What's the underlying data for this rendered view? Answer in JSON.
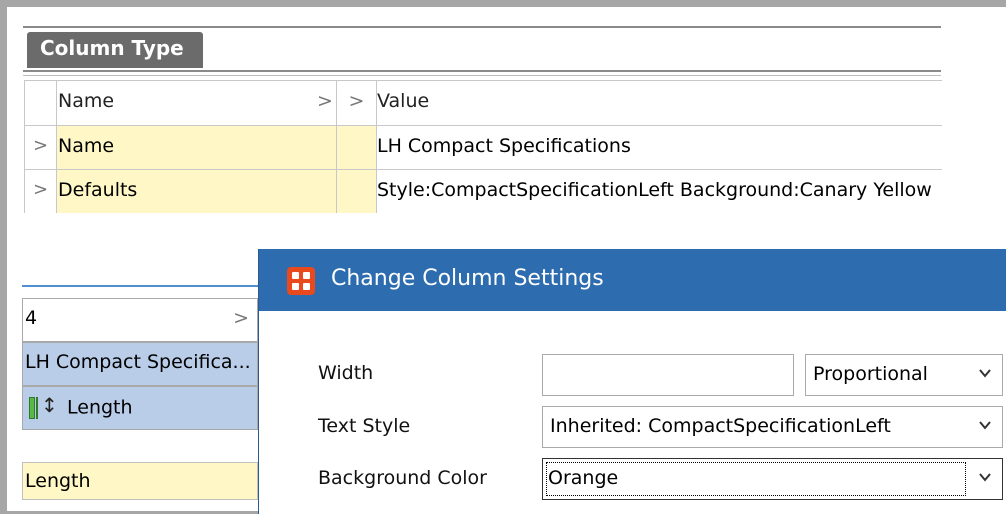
{
  "panel": {
    "tab_label": "Column Type"
  },
  "grid": {
    "header": {
      "name": "Name",
      "sort_glyph": ">",
      "expand_glyph": ">",
      "value": "Value"
    },
    "rows": [
      {
        "expander": ">",
        "name": "Name",
        "value": "LH Compact Specifications"
      },
      {
        "expander": ">",
        "name": "Defaults",
        "value": "Style:CompactSpecificationLeft Background:Canary Yellow"
      }
    ]
  },
  "left_panel": {
    "index_value": "4",
    "index_arrow": ">",
    "column_name": "LH Compact Specifica...",
    "length_label": "Length",
    "selected_value": "Length"
  },
  "dialog": {
    "title": "Change Column Settings",
    "width": {
      "label": "Width",
      "value": "",
      "mode": "Proportional"
    },
    "text_style": {
      "label": "Text Style",
      "value": "Inherited: CompactSpecificationLeft"
    },
    "background": {
      "label": "Background Color",
      "value": "Orange"
    }
  },
  "colors": {
    "title_bar": "#2d6cae",
    "yellow_cell": "#fff8c6",
    "selected_row": "#b9cde8",
    "app_icon": "#e8491d"
  }
}
